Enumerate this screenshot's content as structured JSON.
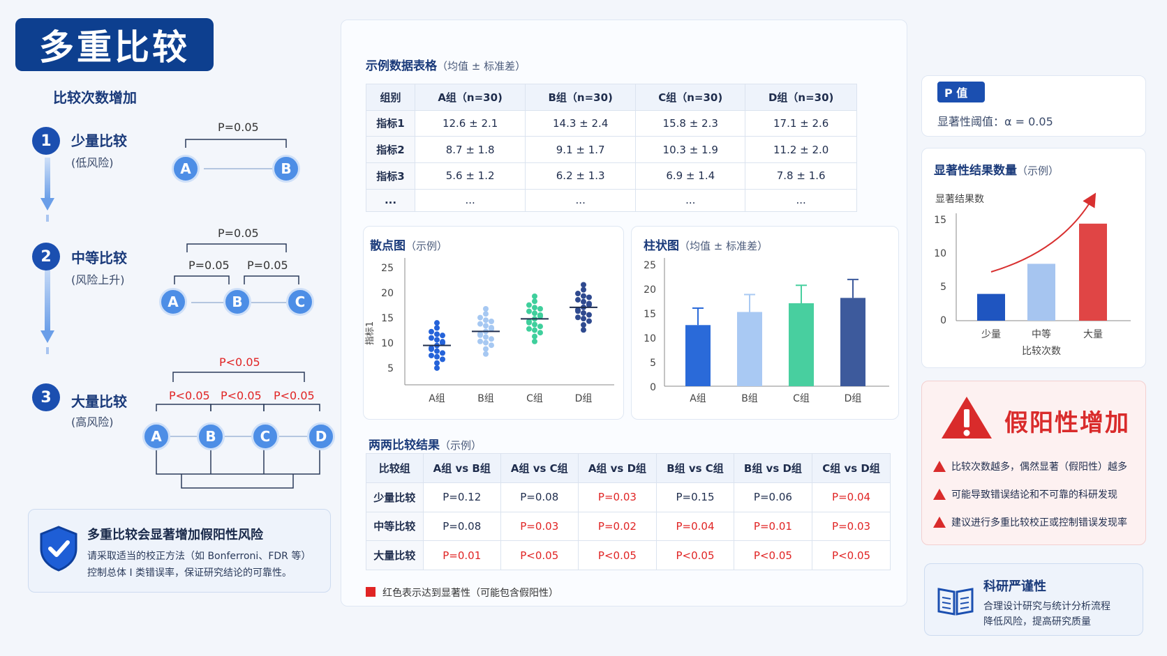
{
  "title": "多重比较",
  "subtitle": "比较次数增加",
  "steps": [
    {
      "num": "1",
      "title": "少量比较",
      "sub": "(低风险)"
    },
    {
      "num": "2",
      "title": "中等比较",
      "sub": "(风险上升)"
    },
    {
      "num": "3",
      "title": "大量比较",
      "sub": "(高风险)"
    }
  ],
  "diagram": {
    "step1": {
      "top": "P=0.05",
      "nodes": [
        "A",
        "B"
      ]
    },
    "step2": {
      "top": "P=0.05",
      "left": "P=0.05",
      "right": "P=0.05",
      "nodes": [
        "A",
        "B",
        "C"
      ]
    },
    "step3": {
      "top": "P<0.05",
      "p1": "P<0.05",
      "p2": "P<0.05",
      "p3": "P<0.05",
      "nodes": [
        "A",
        "B",
        "C",
        "D"
      ]
    }
  },
  "risk_box": {
    "title": "多重比较会显著增加假阳性风险",
    "line1": "请采取适当的校正方法（如 Bonferroni、FDR 等）",
    "line2": "控制总体 I 类错误率，保证研究结论的可靠性。"
  },
  "data_table": {
    "title": "示例数据表格",
    "title_note": "（均值 ± 标准差）",
    "headers": [
      "组别",
      "A组（n=30)",
      "B组（n=30)",
      "C组（n=30)",
      "D组（n=30)"
    ],
    "rows": [
      [
        "指标1",
        "12.6 ± 2.1",
        "14.3 ± 2.4",
        "15.8 ± 2.3",
        "17.1 ± 2.6"
      ],
      [
        "指标2",
        "8.7 ± 1.8",
        "9.1 ± 1.7",
        "10.3 ± 1.9",
        "11.2 ± 2.0"
      ],
      [
        "指标3",
        "5.6 ± 1.2",
        "6.2 ± 1.3",
        "6.9 ± 1.4",
        "7.8 ± 1.6"
      ],
      [
        "...",
        "...",
        "...",
        "...",
        "..."
      ]
    ]
  },
  "scatter": {
    "title": "散点图",
    "title_note": "（示例）",
    "ylabel": "指标1",
    "yticks": [
      "25",
      "20",
      "15",
      "10",
      "5"
    ],
    "categories": [
      "A组",
      "B组",
      "C组",
      "D组"
    ]
  },
  "barchart": {
    "title": "柱状图",
    "title_note": "（均值 ± 标准差）",
    "yticks": [
      "25",
      "20",
      "15",
      "10",
      "5",
      "0"
    ],
    "categories": [
      "A组",
      "B组",
      "C组",
      "D组"
    ]
  },
  "pairwise": {
    "title": "两两比较结果",
    "title_note": "（示例）",
    "headers": [
      "比较组",
      "A组 vs B组",
      "A组 vs C组",
      "A组 vs D组",
      "B组 vs C组",
      "B组 vs D组",
      "C组 vs D组"
    ],
    "rows": [
      [
        "少量比较",
        "P=0.12",
        "P=0.08",
        "P=0.03",
        "P=0.15",
        "P=0.06",
        "P=0.04"
      ],
      [
        "中等比较",
        "P=0.08",
        "P=0.03",
        "P=0.02",
        "P=0.04",
        "P=0.01",
        "P=0.03"
      ],
      [
        "大量比较",
        "P=0.01",
        "P<0.05",
        "P<0.05",
        "P<0.05",
        "P<0.05",
        "P<0.05"
      ]
    ],
    "legend": "红色表示达到显著性（可能包含假阳性）"
  },
  "pvalue_card": {
    "badge": "P 值",
    "text": "显著性阈值：α = 0.05"
  },
  "sig_chart": {
    "title": "显著性结果数量",
    "title_note": "（示例）",
    "ylabel": "显著结果数",
    "xlabel": "比较次数",
    "yticks": [
      "15",
      "10",
      "5",
      "0"
    ]
  },
  "false_positive": {
    "title": "假阳性增加",
    "items": [
      "比较次数越多，偶然显著（假阳性）越多",
      "可能导致错误结论和不可靠的科研发现",
      "建议进行多重比较校正或控制错误发现率"
    ]
  },
  "rigor": {
    "title": "科研严谨性",
    "line1": "合理设计研究与统计分析流程",
    "line2": "降低风险，提高研究质量"
  },
  "chart_data": [
    {
      "type": "scatter",
      "title": "散点图",
      "ylabel": "指标1",
      "categories": [
        "A组",
        "B组",
        "C组",
        "D组"
      ],
      "ylim": [
        0,
        25
      ],
      "means": [
        10.2,
        13.0,
        15.5,
        17.8
      ],
      "colors": [
        "#2563d9",
        "#a6c8f2",
        "#3fcf9c",
        "#2f4a8f"
      ]
    },
    {
      "type": "bar",
      "title": "柱状图",
      "categories": [
        "A组",
        "B组",
        "C组",
        "D组"
      ],
      "values": [
        12.6,
        15.3,
        17.1,
        18.2
      ],
      "errors": [
        3.5,
        3.6,
        3.7,
        3.8
      ],
      "ylim": [
        0,
        25
      ],
      "colors": [
        "#2a6ad9",
        "#a9c9f3",
        "#48cf9f",
        "#3d5a9c"
      ]
    },
    {
      "type": "bar",
      "title": "显著性结果数量",
      "ylabel": "显著结果数",
      "xlabel": "比较次数",
      "categories": [
        "少量",
        "中等",
        "大量"
      ],
      "values": [
        4,
        8.5,
        14.5
      ],
      "ylim": [
        0,
        15
      ],
      "colors": [
        "#1f55c0",
        "#a6c5f0",
        "#e04545"
      ]
    }
  ]
}
